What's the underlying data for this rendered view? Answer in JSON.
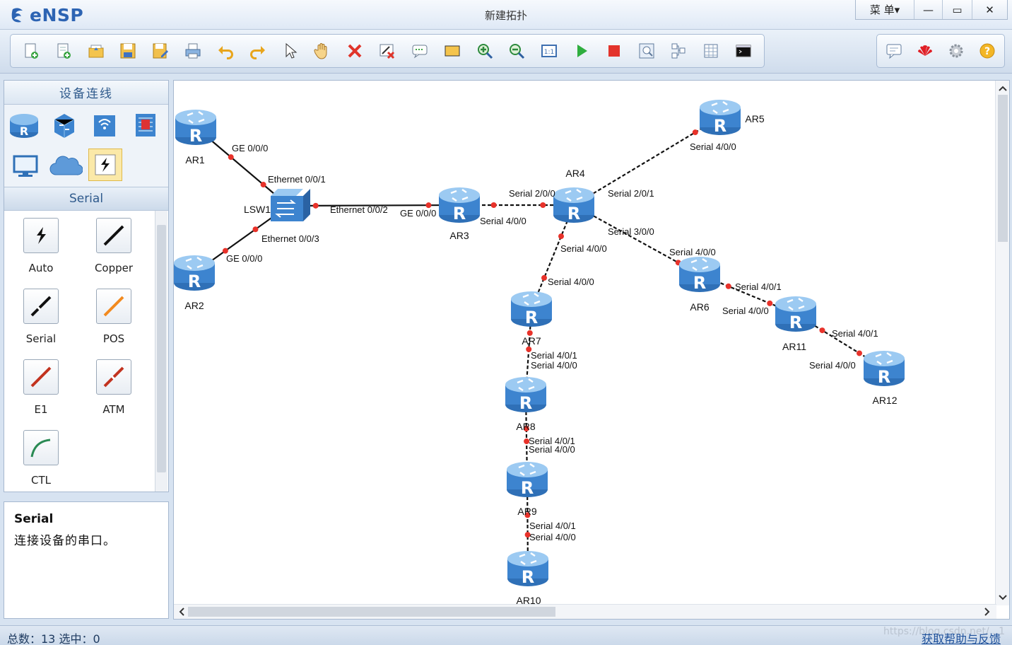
{
  "app": {
    "name": "eNSP",
    "title": "新建拓扑"
  },
  "window_controls": {
    "menu": "菜 单▾",
    "minimize": "—",
    "maximize": "▭",
    "close": "✕"
  },
  "toolbar": {
    "left_icons": [
      "new-topology-icon",
      "new-example-icon",
      "open-icon",
      "save-icon",
      "save-as-icon",
      "print-icon",
      "undo-icon",
      "redo-icon",
      "select-icon",
      "pan-hand-icon",
      "delete-icon",
      "delete-all-links-icon",
      "text-annotation-icon",
      "rectangle-annotation-icon",
      "zoom-in-icon",
      "zoom-out-icon",
      "fit-view-icon",
      "start-device-icon",
      "stop-device-icon",
      "capture-icon",
      "show-ports-icon",
      "grid-icon",
      "command-line-icon"
    ],
    "right_icons": [
      "chat-icon",
      "huawei-icon",
      "settings-icon",
      "help-icon"
    ]
  },
  "device_panel": {
    "title": "设备连线",
    "categories": [
      "router-icon",
      "switch-icon",
      "wlan-icon",
      "firewall-icon",
      "pc-icon",
      "cloud-icon",
      "connection-icon"
    ],
    "selected_category": "Serial",
    "cables": [
      {
        "label": "Auto",
        "color": "#111111"
      },
      {
        "label": "Copper",
        "color": "#111111"
      },
      {
        "label": "Serial",
        "color": "#111111"
      },
      {
        "label": "POS",
        "color": "#f28a1f"
      },
      {
        "label": "E1",
        "color": "#c2331f"
      },
      {
        "label": "ATM",
        "color": "#c2331f"
      },
      {
        "label": "CTL",
        "color": "#2a8a54"
      }
    ]
  },
  "description": {
    "title": "Serial",
    "text": "连接设备的串口。"
  },
  "topology": {
    "devices": [
      {
        "name": "AR1",
        "type": "router"
      },
      {
        "name": "AR2",
        "type": "router"
      },
      {
        "name": "LSW1",
        "type": "switch"
      },
      {
        "name": "AR3",
        "type": "router"
      },
      {
        "name": "AR4",
        "type": "router"
      },
      {
        "name": "AR5",
        "type": "router"
      },
      {
        "name": "AR6",
        "type": "router"
      },
      {
        "name": "AR7",
        "type": "router"
      },
      {
        "name": "AR8",
        "type": "router"
      },
      {
        "name": "AR9",
        "type": "router"
      },
      {
        "name": "AR10",
        "type": "router"
      },
      {
        "name": "AR11",
        "type": "router"
      },
      {
        "name": "AR12",
        "type": "router"
      }
    ],
    "ports": [
      "GE 0/0/0",
      "Ethernet 0/0/1",
      "GE 0/0/0",
      "Ethernet 0/0/3",
      "Ethernet 0/0/2",
      "GE 0/0/0",
      "Serial 4/0/0",
      "Serial 2/0/0",
      "Serial 2/0/1",
      "Serial 4/0/0",
      "Serial 3/0/0",
      "Serial 4/0/0",
      "Serial 4/0/0",
      "Serial 4/0/0",
      "Serial 4/0/1",
      "Serial 4/0/0",
      "Serial 4/0/1",
      "Serial 4/0/0",
      "Serial 4/0/1",
      "Serial 4/0/0",
      "Serial 4/0/1",
      "Serial 4/0/0",
      "Serial 4/0/1",
      "Serial 4/0/0"
    ]
  },
  "status": {
    "total": "总数：13  选中：0",
    "help_link": "获取帮助与反馈",
    "watermark": "https://blog.csdn.net/...1"
  }
}
